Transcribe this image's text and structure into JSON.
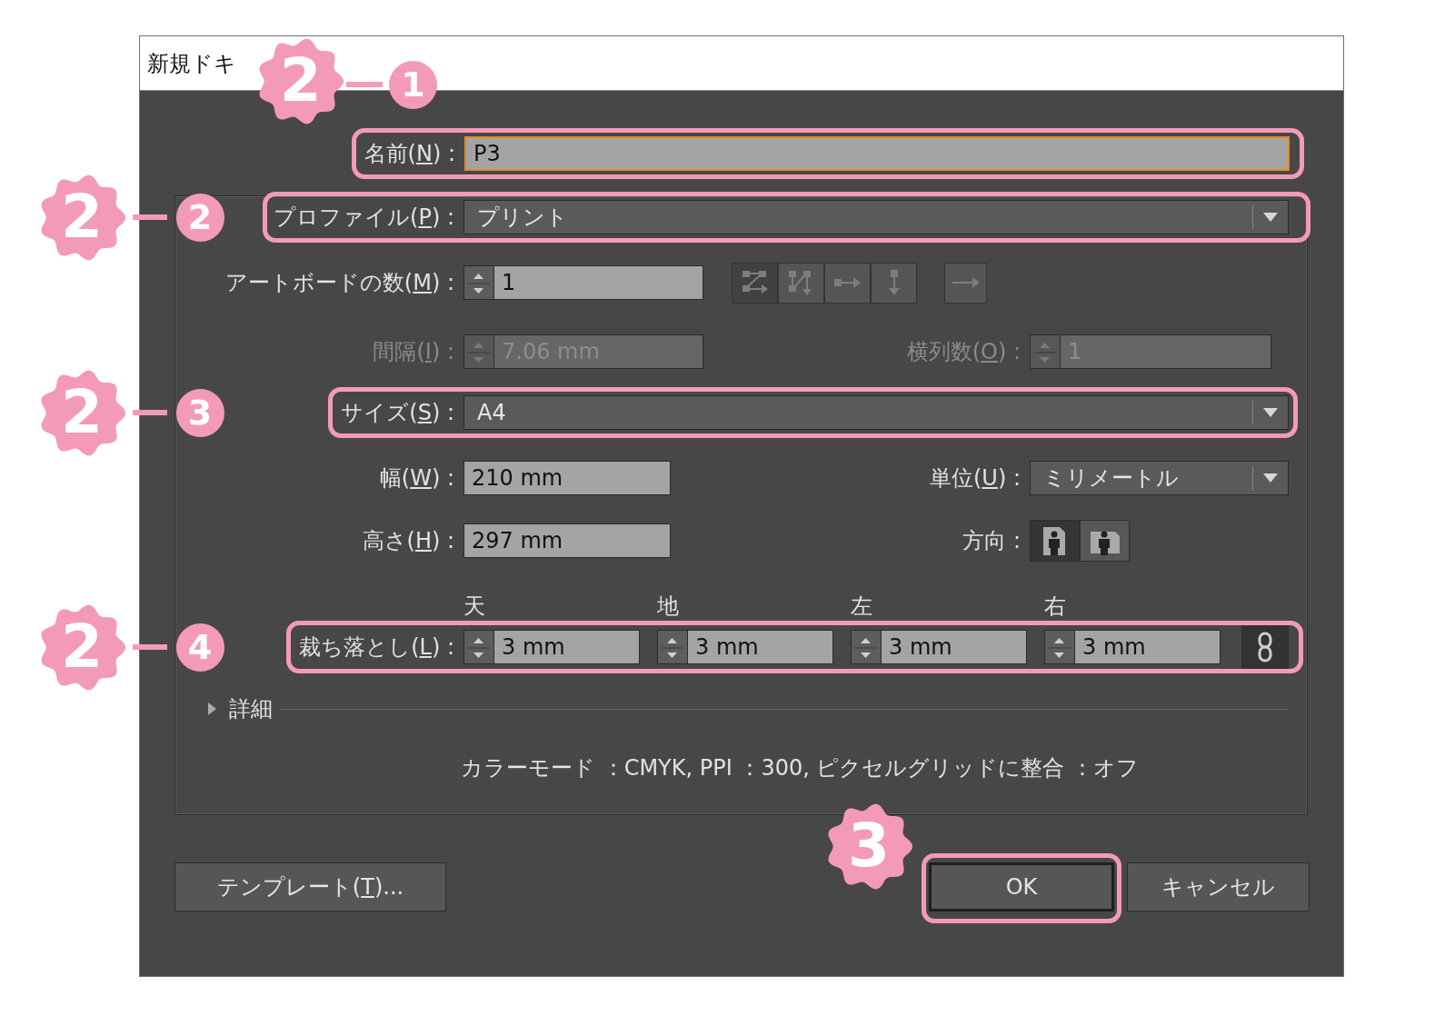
{
  "window": {
    "title": "新規ドキ"
  },
  "name": {
    "label": {
      "before": "名前(",
      "key": "N",
      "after": ") :"
    },
    "value": "P3",
    "focused": true,
    "highlighted": true,
    "callout": {
      "step": "2",
      "sub": "1",
      "kind": "above"
    }
  },
  "profile": {
    "label": {
      "before": "プロファイル(",
      "key": "P",
      "after": ") :"
    },
    "value": "プリント",
    "highlighted": true,
    "callout": {
      "step": "2",
      "sub": "2",
      "kind": "left"
    }
  },
  "artboards": {
    "label": {
      "before": "アートボードの数(",
      "key": "M",
      "after": ") :"
    },
    "value": "1",
    "arrange_buttons": [
      {
        "kind": "grid_by_row",
        "selected": true
      },
      {
        "kind": "grid_by_column",
        "selected": false
      },
      {
        "kind": "row",
        "selected": false
      },
      {
        "kind": "column",
        "selected": false
      }
    ]
  },
  "spacing": {
    "label": {
      "before": "間隔(",
      "key": "I",
      "after": ") :"
    },
    "value": "7.06 mm",
    "disabled": true
  },
  "columns": {
    "label": {
      "before": "横列数(",
      "key": "O",
      "after": ") :"
    },
    "value": "1",
    "disabled": true
  },
  "size": {
    "label": {
      "before": "サイズ(",
      "key": "S",
      "after": ") :"
    },
    "value": "A4",
    "highlighted": true,
    "callout": {
      "step": "2",
      "sub": "3",
      "kind": "left"
    }
  },
  "width": {
    "label": {
      "before": "幅(",
      "key": "W",
      "after": ") :"
    },
    "value": "210 mm"
  },
  "units": {
    "label": {
      "before": "単位(",
      "key": "U",
      "after": ") :"
    },
    "value": "ミリメートル"
  },
  "height": {
    "label": {
      "before": "高さ(",
      "key": "H",
      "after": ") :"
    },
    "value": "297 mm"
  },
  "orientation": {
    "label": {
      "before": "方向 :"
    },
    "options": [
      {
        "kind": "portrait",
        "selected": true
      },
      {
        "kind": "landscape",
        "selected": false
      }
    ]
  },
  "bleed": {
    "label": {
      "before": "裁ち落とし(",
      "key": "L",
      "after": ") :"
    },
    "sides": [
      {
        "heading": "天",
        "value": "3 mm"
      },
      {
        "heading": "地",
        "value": "3 mm"
      },
      {
        "heading": "左",
        "value": "3 mm"
      },
      {
        "heading": "右",
        "value": "3 mm"
      }
    ],
    "linked": true,
    "highlighted": true,
    "callout": {
      "step": "2",
      "sub": "4",
      "kind": "left"
    }
  },
  "details": {
    "label": "詳細",
    "expanded": false
  },
  "summary": "カラーモード ：CMYK, PPI ：300, ピクセルグリッドに整合 ：オフ",
  "buttons": [
    {
      "label": {
        "before": "テンプレート(",
        "key": "T",
        "after": ")..."
      },
      "default": false
    },
    {
      "label": {
        "before": "OK"
      },
      "default": true,
      "highlighted": true,
      "callout": {
        "step": "3",
        "kind": "corner"
      }
    },
    {
      "label": {
        "before": "キャンセル"
      },
      "default": false
    }
  ]
}
